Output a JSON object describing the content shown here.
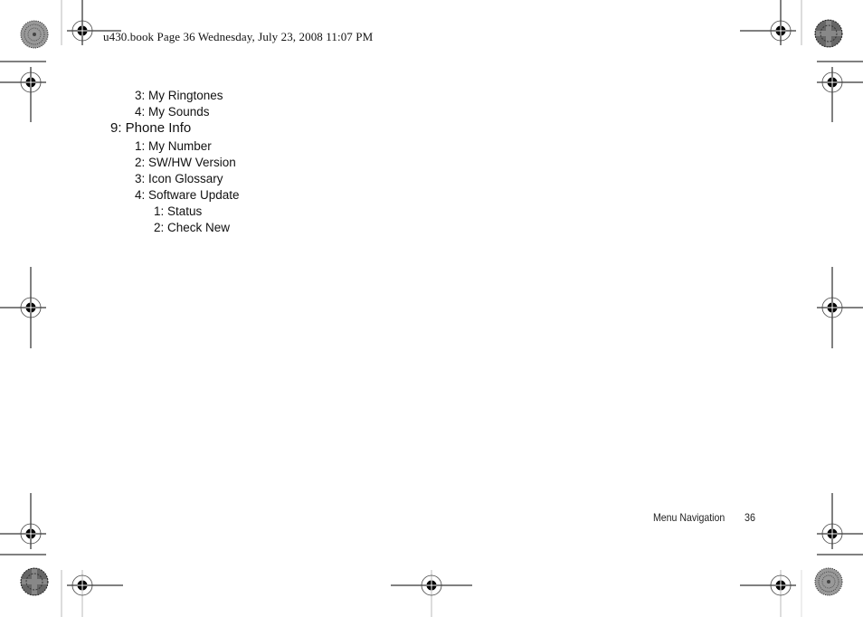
{
  "header": {
    "stamp": "u430.book  Page 36  Wednesday, July 23, 2008  11:07 PM"
  },
  "menu": {
    "items": [
      {
        "level": 2,
        "label": "3: My Ringtones"
      },
      {
        "level": 2,
        "label": "4: My Sounds"
      },
      {
        "level": 1,
        "label": "9: Phone Info"
      },
      {
        "level": 2,
        "label": "1: My Number"
      },
      {
        "level": 2,
        "label": "2: SW/HW Version"
      },
      {
        "level": 2,
        "label": "3: Icon Glossary"
      },
      {
        "level": 2,
        "label": "4: Software Update"
      },
      {
        "level": 3,
        "label": "1: Status"
      },
      {
        "level": 3,
        "label": "2: Check New"
      }
    ]
  },
  "footer": {
    "section": "Menu Navigation",
    "page_number": "36"
  },
  "icons": {
    "registration_mark": "registration-crosshair-icon",
    "color_bar": "starburst-target-icon"
  }
}
